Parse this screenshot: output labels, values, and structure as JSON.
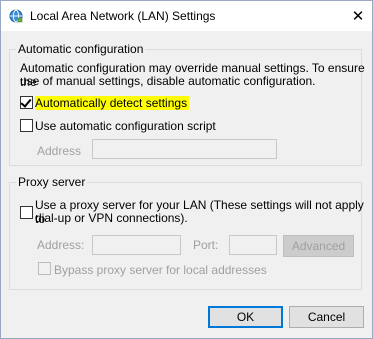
{
  "window": {
    "title": "Local Area Network (LAN) Settings",
    "close_symbol": "✕",
    "icon": "network-settings-icon"
  },
  "auto_config": {
    "group_label": "Automatic configuration",
    "description_line1": "Automatic configuration may override manual settings.  To ensure the",
    "description_line2": "use of manual settings, disable automatic configuration.",
    "auto_detect_label": "Automatically detect settings",
    "auto_detect_checked": true,
    "script_label": "Use automatic configuration script",
    "script_checked": false,
    "address_label": "Address",
    "address_value": ""
  },
  "proxy": {
    "group_label": "Proxy server",
    "use_proxy_line1": "Use a proxy server for your LAN (These settings will not apply to",
    "use_proxy_line2": "dial-up or VPN connections).",
    "use_proxy_checked": false,
    "address_label": "Address:",
    "address_value": "",
    "port_label": "Port:",
    "port_value": "",
    "advanced_label": "Advanced",
    "bypass_label": "Bypass proxy server for local addresses",
    "bypass_checked": false
  },
  "footer": {
    "ok_label": "OK",
    "cancel_label": "Cancel"
  },
  "colors": {
    "highlight": "#ffff00",
    "accent": "#0078d7"
  }
}
